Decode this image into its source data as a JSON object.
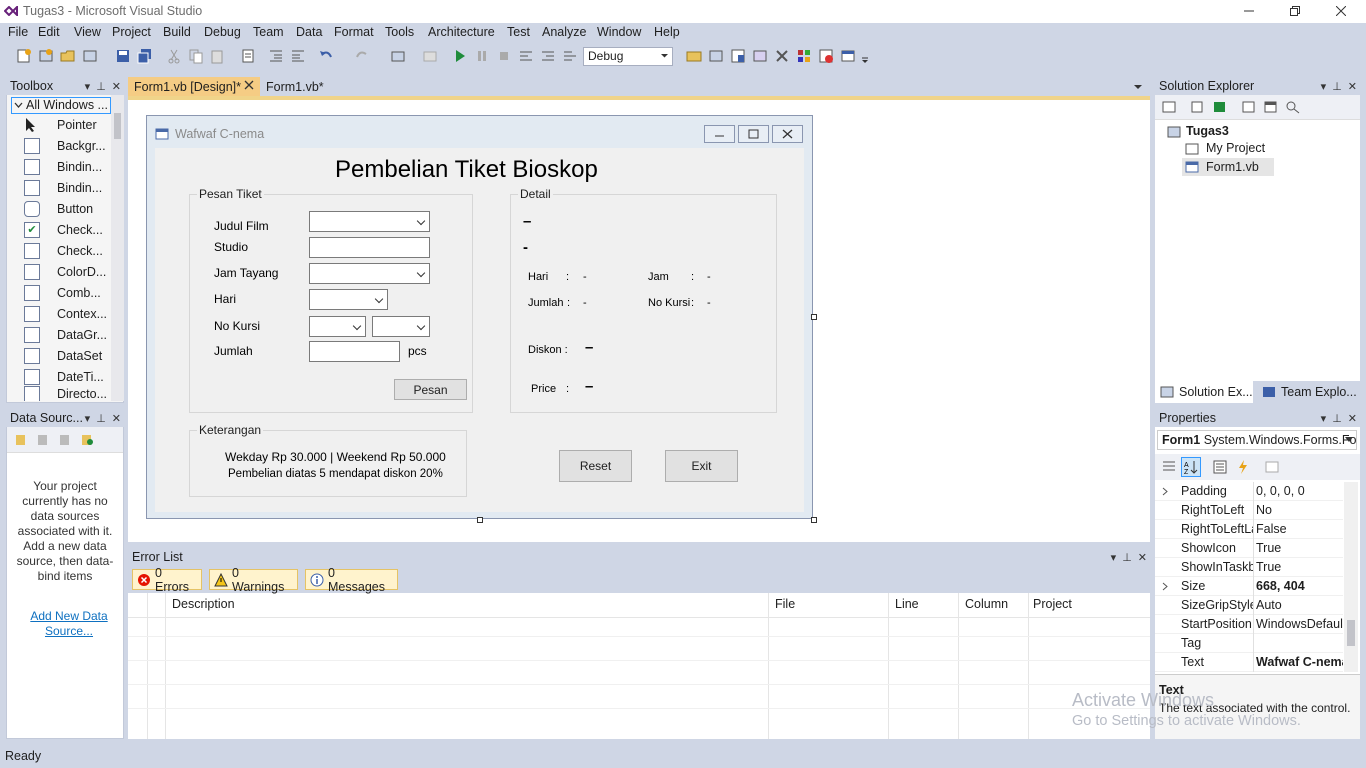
{
  "app": {
    "title": "Tugas3 - Microsoft Visual Studio"
  },
  "menu": [
    "File",
    "Edit",
    "View",
    "Project",
    "Build",
    "Debug",
    "Team",
    "Data",
    "Format",
    "Tools",
    "Architecture",
    "Test",
    "Analyze",
    "Window",
    "Help"
  ],
  "toolbar": {
    "config": "Debug"
  },
  "toolbox": {
    "title": "Toolbox",
    "group": "All Windows ...",
    "items": [
      "Pointer",
      "Backgr...",
      "Bindin...",
      "Bindin...",
      "Button",
      "Check...",
      "Check...",
      "ColorD...",
      "Comb...",
      "Contex...",
      "DataGr...",
      "DataSet",
      "DateTi...",
      "Directo..."
    ]
  },
  "datasources": {
    "title": "Data Sourc...",
    "message": "Your project currently has no data sources associated with it. Add a new data source, then data-bind items",
    "link": "Add New Data Source..."
  },
  "tabs": [
    {
      "label": "Form1.vb [Design]*"
    },
    {
      "label": "Form1.vb*"
    }
  ],
  "form": {
    "title": "Wafwaf C-nema",
    "heading": "Pembelian Tiket Bioskop",
    "pesan": {
      "title": "Pesan Tiket",
      "judul": "Judul Film",
      "studio": "Studio",
      "jam": "Jam Tayang",
      "hari": "Hari",
      "kursi": "No Kursi",
      "jumlah": "Jumlah",
      "pcs": "pcs",
      "button": "Pesan"
    },
    "detail": {
      "title": "Detail",
      "dash1": "–",
      "dash2": "-",
      "hari": "Hari",
      "colon": ":",
      "hari_val": "-",
      "jam": "Jam",
      "jam_val": "-",
      "jumlah": "Jumlah",
      "jumlah_val": "-",
      "kursi": "No Kursi",
      "kursi_val": "-",
      "diskon": "Diskon :",
      "diskon_val": "–",
      "price": "Price",
      "price_val": "–"
    },
    "keterangan": {
      "title": "Keterangan",
      "line1": "Wekday Rp 30.000 | Weekend Rp 50.000",
      "line2": "Pembelian diatas 5 mendapat diskon 20%"
    },
    "reset": "Reset",
    "exit": "Exit"
  },
  "errors": {
    "title": "Error List",
    "errors": "0 Errors",
    "warnings": "0 Warnings",
    "messages": "0 Messages",
    "columns": [
      "Description",
      "File",
      "Line",
      "Column",
      "Project"
    ]
  },
  "solution": {
    "title": "Solution Explorer",
    "project": "Tugas3",
    "myproject": "My Project",
    "form": "Form1.vb",
    "tab1": "Solution Ex...",
    "tab2": "Team Explo..."
  },
  "properties": {
    "title": "Properties",
    "object": "Form1",
    "type": "System.Windows.Forms.Fo",
    "rows": [
      [
        "Padding",
        "0, 0, 0, 0"
      ],
      [
        "RightToLeft",
        "No"
      ],
      [
        "RightToLeftLa",
        "False"
      ],
      [
        "ShowIcon",
        "True"
      ],
      [
        "ShowInTaskba",
        "True"
      ],
      [
        "Size",
        "668, 404"
      ],
      [
        "SizeGripStyle",
        "Auto"
      ],
      [
        "StartPosition",
        "WindowsDefault"
      ],
      [
        "Tag",
        ""
      ],
      [
        "Text",
        "Wafwaf C-nema"
      ]
    ],
    "desc_title": "Text",
    "desc": "The text associated with the control."
  },
  "status": "Ready",
  "watermark": {
    "line1": "Activate Windows",
    "line2": "Go to Settings to activate Windows."
  }
}
